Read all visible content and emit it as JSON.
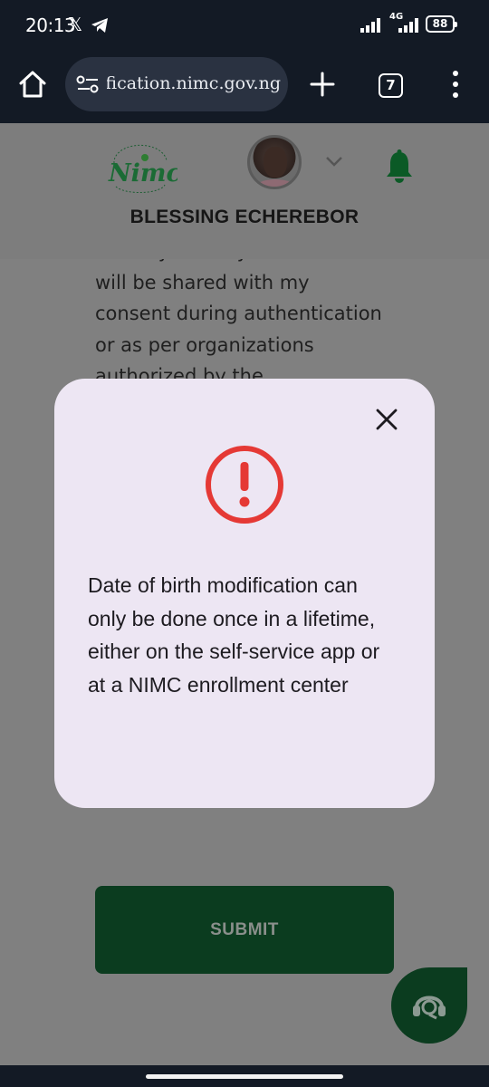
{
  "status_bar": {
    "time": "20:13",
    "network_label": "4G",
    "battery": "88"
  },
  "browser": {
    "url": "modification.nimc.gov.ng",
    "tab_count": "7"
  },
  "header": {
    "logo_text": "Nimc",
    "user_name": "BLESSING ECHEREBOR"
  },
  "page": {
    "consent_lines": [
      "that my identity information",
      "will be shared with my",
      "consent during authentication",
      "or as per organizations",
      "authorized by the"
    ],
    "submit_label": "SUBMIT"
  },
  "modal": {
    "message": "Date of birth modification can only be done once in a lifetime, either on the self-service app or at a NIMC enrollment center"
  },
  "colors": {
    "alert_red": "#e53935",
    "nimc_green": "#0b3c1f",
    "modal_bg": "#ede6f3"
  },
  "icons": [
    "x-logo-icon",
    "telegram-icon",
    "signal-icon",
    "battery-icon",
    "home-icon",
    "site-settings-icon",
    "plus-icon",
    "tabs-icon",
    "more-vert-icon",
    "chevron-down-icon",
    "bell-icon",
    "close-icon",
    "alert-icon",
    "support-agent-icon"
  ]
}
